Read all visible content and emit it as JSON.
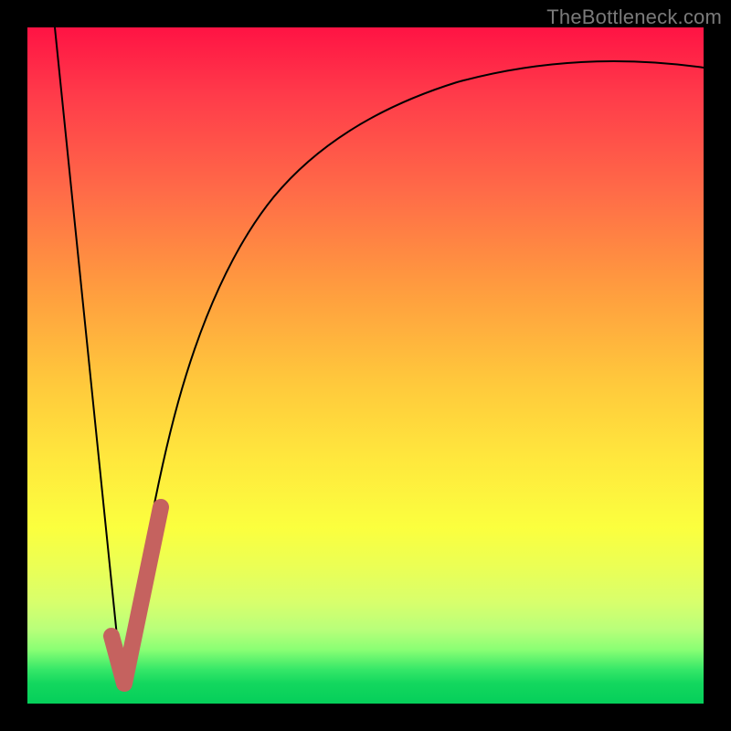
{
  "watermark": "TheBottleneck.com",
  "chart_data": {
    "type": "line",
    "title": "",
    "xlabel": "",
    "ylabel": "",
    "xlim": [
      0,
      100
    ],
    "ylim": [
      0,
      100
    ],
    "grid": false,
    "legend": false,
    "series": [
      {
        "name": "left-descent",
        "x": [
          4,
          14
        ],
        "values": [
          100,
          2
        ],
        "stroke": "#000000",
        "width": 2
      },
      {
        "name": "right-curve",
        "x": [
          14,
          18,
          22,
          26,
          30,
          35,
          40,
          46,
          52,
          60,
          70,
          82,
          100
        ],
        "values": [
          2,
          26,
          44,
          56,
          65,
          72,
          77,
          82,
          85,
          88,
          91,
          92.5,
          94
        ],
        "stroke": "#000000",
        "width": 2
      },
      {
        "name": "check-mark",
        "x": [
          12,
          14,
          19.5
        ],
        "values": [
          9,
          3,
          29
        ],
        "stroke": "#c5625f",
        "width": 18
      }
    ],
    "background_gradient": {
      "direction": "top-to-bottom",
      "stops": [
        {
          "pos": 0.0,
          "color": "#ff1344"
        },
        {
          "pos": 0.5,
          "color": "#ffcc3d"
        },
        {
          "pos": 0.8,
          "color": "#eaff56"
        },
        {
          "pos": 1.0,
          "color": "#05cf5a"
        }
      ]
    }
  }
}
